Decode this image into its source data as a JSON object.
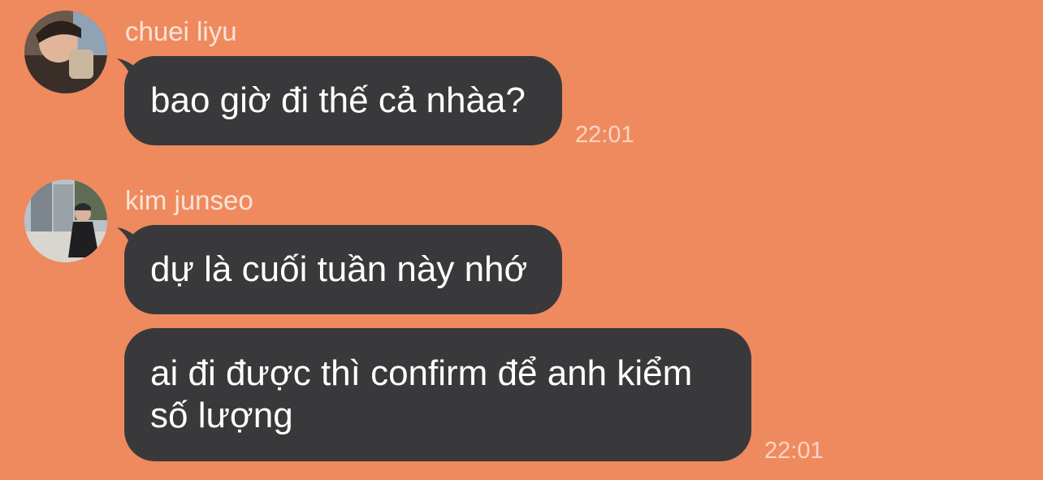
{
  "background_color": "#ef8a5e",
  "bubble_color": "#39393b",
  "messages": [
    {
      "sender": "chuei liyu",
      "avatar_icon": "user-avatar-icon",
      "text": "bao giờ đi thế cả nhàa?",
      "time": "22:01"
    },
    {
      "sender": "kim junseo",
      "avatar_icon": "user-avatar-icon",
      "text": "dự là cuối tuần này nhớ"
    },
    {
      "text": "ai đi được thì confirm để anh kiểm số lượng",
      "time": "22:01"
    }
  ]
}
